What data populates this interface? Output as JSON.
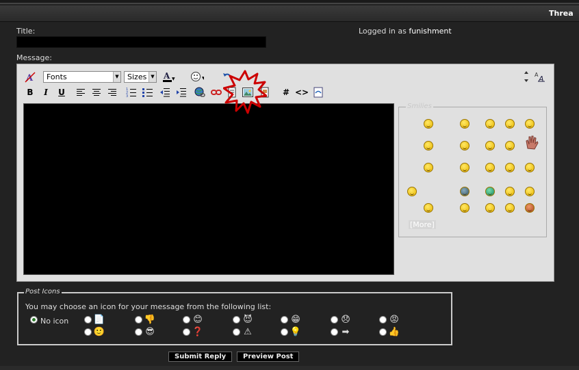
{
  "header": {
    "title_fragment": "Threa"
  },
  "form": {
    "title_label": "Title:",
    "title_value": "",
    "logged_in_prefix": "Logged in as ",
    "username": "funishment",
    "message_label": "Message:"
  },
  "editor": {
    "fonts_label": "Fonts",
    "sizes_label": "Sizes",
    "bold": "B",
    "italic": "I",
    "underline": "U",
    "code_tag": "#",
    "html_tag": "<>"
  },
  "smilies": {
    "legend": "Smilies",
    "more": "[More]"
  },
  "post_icons": {
    "legend": "Post Icons",
    "prompt": "You may choose an icon for your message from the following list:",
    "no_icon": "No icon",
    "selected": "no-icon"
  },
  "buttons": {
    "submit": "Submit Reply",
    "preview": "Preview Post"
  },
  "colors": {
    "background": "#222222",
    "editor_bg": "#e0e0e0",
    "highlight": "#cc0000"
  }
}
